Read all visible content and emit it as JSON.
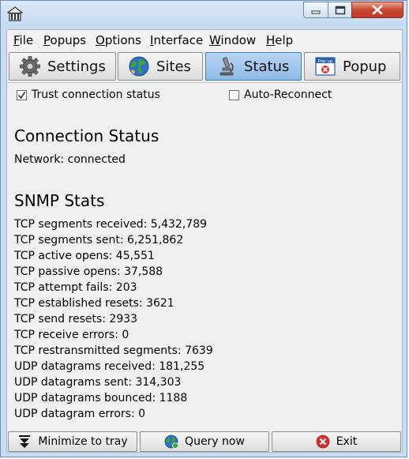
{
  "menu": [
    "File",
    "Popups",
    "Options",
    "Interface",
    "Window",
    "Help"
  ],
  "menu_accel": [
    "F",
    "P",
    "O",
    "I",
    "W",
    "H"
  ],
  "menu_rest": [
    "ile",
    "opups",
    "ptions",
    "nterface",
    "indow",
    "elp"
  ],
  "tabs": [
    {
      "label": "Settings",
      "icon": "gear-icon",
      "active": false
    },
    {
      "label": "Sites",
      "icon": "globe-icon",
      "active": false
    },
    {
      "label": "Status",
      "icon": "microscope-icon",
      "active": true
    },
    {
      "label": "Popup",
      "icon": "popup-icon",
      "active": false
    }
  ],
  "options": {
    "trust_label": "Trust connection status",
    "trust_checked": true,
    "reconnect_label": "Auto-Reconnect",
    "reconnect_checked": false
  },
  "connection": {
    "heading": "Connection Status",
    "network": "Network: connected"
  },
  "snmp": {
    "heading": "SNMP Stats",
    "lines": [
      "TCP segments received: 5,432,789",
      "TCP segments sent: 6,251,862",
      "TCP active opens: 45,551",
      "TCP passive opens: 37,588",
      "TCP attempt fails: 203",
      "TCP established resets: 3621",
      "TCP send resets: 2933",
      "TCP receive errors: 0",
      "TCP restransmitted segments: 7639",
      "UDP datagrams received: 181,255",
      "UDP datagrams sent: 314,303",
      "UDP datagrams bounced: 1188",
      "UDP datagram errors: 0"
    ]
  },
  "bottom": {
    "minimize_label": "Minimize to tray",
    "query_label": "Query now",
    "exit_label": "Exit"
  },
  "popup_icon_text": "Pop up",
  "colors": {
    "active_tab": "#9cc4ee",
    "exit_red": "#d9312b",
    "close_button": "#c6492f"
  }
}
